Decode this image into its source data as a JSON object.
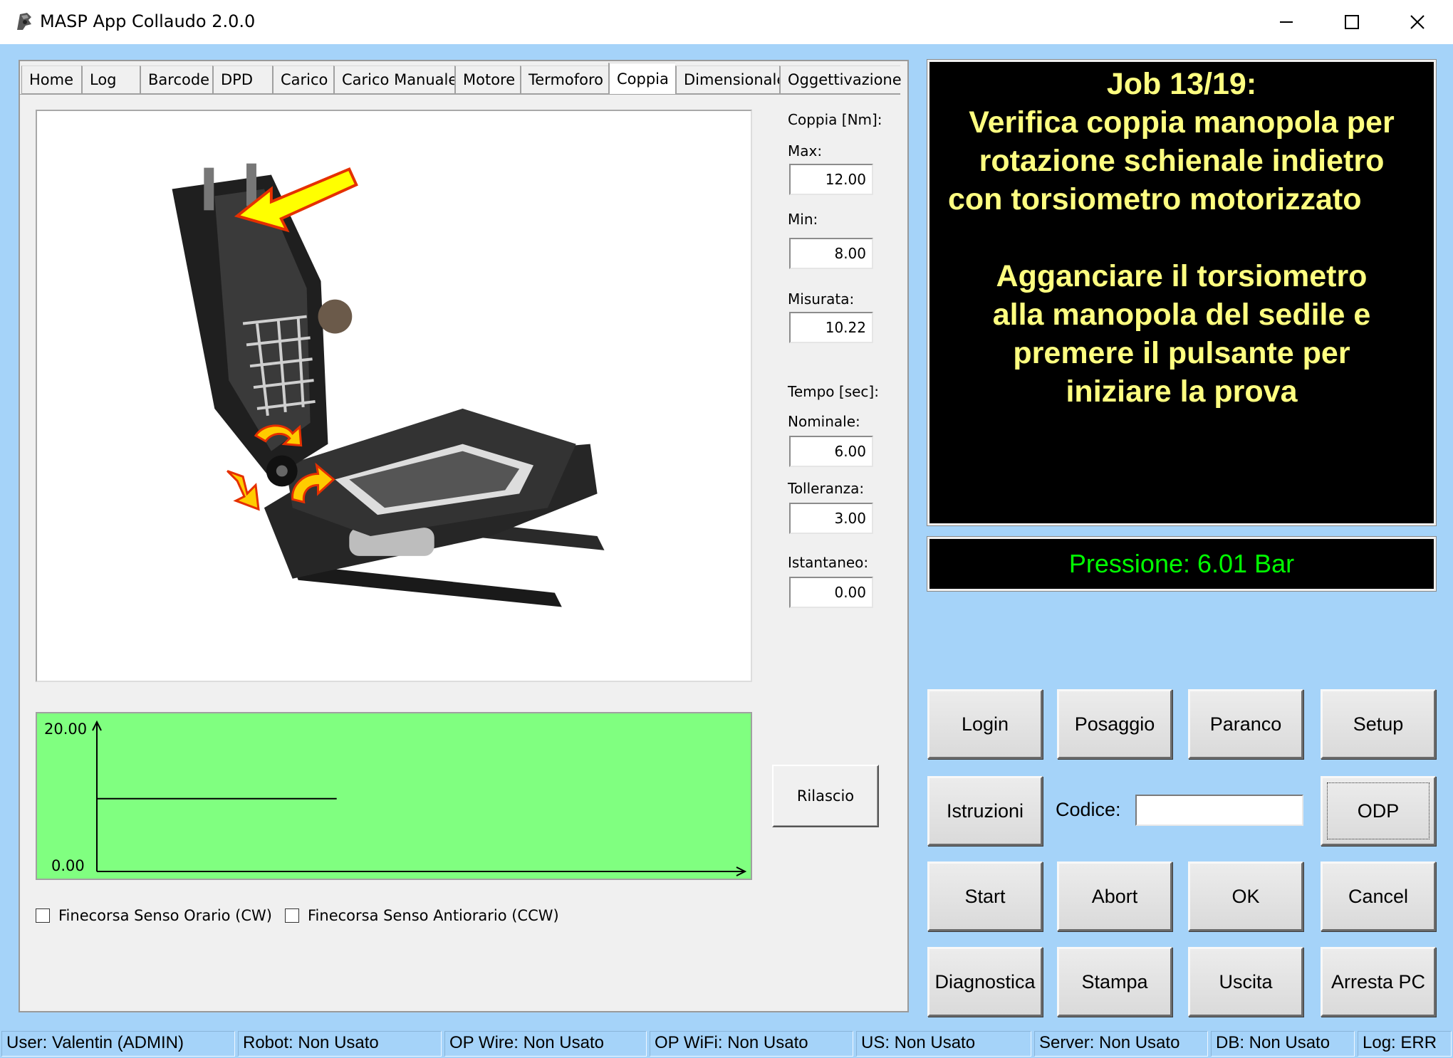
{
  "window": {
    "title": "MASP App Collaudo 2.0.0",
    "minimize_icon": "minimize-icon",
    "maximize_icon": "maximize-icon",
    "close_icon": "close-icon"
  },
  "tabs": [
    {
      "label": "Home"
    },
    {
      "label": "Log"
    },
    {
      "label": "Barcode"
    },
    {
      "label": "DPD"
    },
    {
      "label": "Carico"
    },
    {
      "label": "Carico Manuale"
    },
    {
      "label": "Motore"
    },
    {
      "label": "Termoforo"
    },
    {
      "label": "Coppia",
      "active": true
    },
    {
      "label": "Dimensionale"
    },
    {
      "label": "Oggettivazione"
    }
  ],
  "coppia": {
    "section_label": "Coppia [Nm]:",
    "max_label": "Max:",
    "max_value": "12.00",
    "min_label": "Min:",
    "min_value": "8.00",
    "misurata_label": "Misurata:",
    "misurata_value": "10.22"
  },
  "tempo": {
    "section_label": "Tempo [sec]:",
    "nominale_label": "Nominale:",
    "nominale_value": "6.00",
    "tolleranza_label": "Tolleranza:",
    "tolleranza_value": "3.00",
    "istantaneo_label": "Istantaneo:",
    "istantaneo_value": "0.00"
  },
  "graph": {
    "y_max_label": "20.00",
    "y_min_label": "0.00",
    "background_color": "#80ff80",
    "trace_level": 10.22,
    "trace_end_fraction": 0.37
  },
  "rilascio_label": "Rilascio",
  "checkboxes": {
    "cw_label": "Finecorsa Senso Orario (CW)",
    "ccw_label": "Finecorsa Senso Antiorario (CCW)"
  },
  "job": {
    "title": "Job 13/19:",
    "line1": "Verifica coppia manopola per",
    "line2": "rotazione schienale indietro",
    "line3": "con torsiometro motorizzato",
    "line4": "Agganciare il torsiometro",
    "line5": "alla manopola del sedile e",
    "line6": "premere il pulsante per",
    "line7": "iniziare la prova",
    "text_color": "#ffff80"
  },
  "pressure": {
    "text": "Pressione: 6.01 Bar",
    "text_color": "#00ff00"
  },
  "buttons": {
    "login": "Login",
    "posaggio": "Posaggio",
    "paranco": "Paranco",
    "setup": "Setup",
    "istruzioni": "Istruzioni",
    "codice_label": "Codice:",
    "codice_value": "",
    "odp": "ODP",
    "start": "Start",
    "abort": "Abort",
    "ok": "OK",
    "cancel": "Cancel",
    "diagnostica": "Diagnostica",
    "stampa": "Stampa",
    "uscita": "Uscita",
    "arresta": "Arresta PC"
  },
  "status": {
    "user": "User: Valentin (ADMIN)",
    "robot": "Robot: Non Usato",
    "op_wire": "OP Wire: Non Usato",
    "op_wifi": "OP WiFi: Non Usato",
    "us": "US: Non Usato",
    "server": "Server: Non Usato",
    "db": "DB: Non Usato",
    "log": "Log: ERR"
  },
  "colors": {
    "client_background": "#a5d3f9",
    "panel_background": "#f0f0f0"
  }
}
